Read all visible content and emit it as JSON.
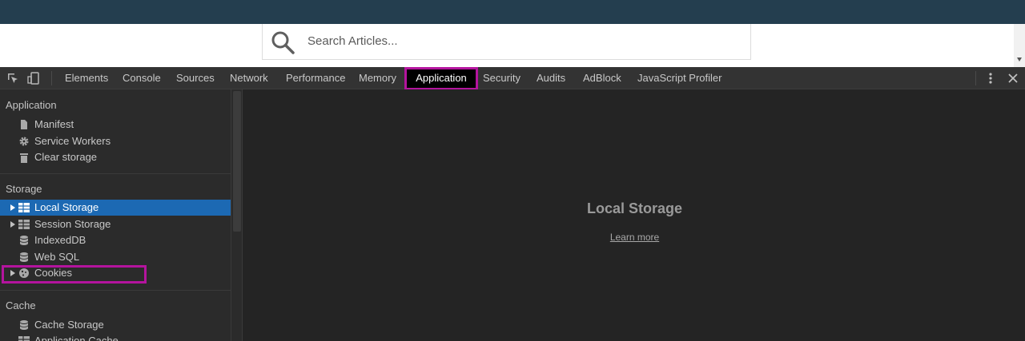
{
  "webpage": {
    "search": {
      "placeholder": "Search Articles..."
    }
  },
  "devtools": {
    "tabs": [
      {
        "label": "Elements"
      },
      {
        "label": "Console"
      },
      {
        "label": "Sources"
      },
      {
        "label": "Network"
      },
      {
        "label": "Performance"
      },
      {
        "label": "Memory"
      },
      {
        "label": "Application",
        "active": true
      },
      {
        "label": "Security"
      },
      {
        "label": "Audits"
      },
      {
        "label": "AdBlock"
      },
      {
        "label": "JavaScript Profiler"
      }
    ],
    "sidebar": {
      "sections": [
        {
          "title": "Application",
          "items": [
            {
              "label": "Manifest",
              "icon": "document-icon"
            },
            {
              "label": "Service Workers",
              "icon": "gear-icon"
            },
            {
              "label": "Clear storage",
              "icon": "trash-icon"
            }
          ]
        },
        {
          "title": "Storage",
          "items": [
            {
              "label": "Local Storage",
              "icon": "grid-icon",
              "expandable": true,
              "selected": true
            },
            {
              "label": "Session Storage",
              "icon": "grid-icon",
              "expandable": true
            },
            {
              "label": "IndexedDB",
              "icon": "database-icon"
            },
            {
              "label": "Web SQL",
              "icon": "database-icon"
            },
            {
              "label": "Cookies",
              "icon": "cookie-icon",
              "expandable": true
            }
          ]
        },
        {
          "title": "Cache",
          "items": [
            {
              "label": "Cache Storage",
              "icon": "database-icon"
            },
            {
              "label": "Application Cache",
              "icon": "grid-icon"
            }
          ]
        }
      ]
    },
    "main": {
      "title": "Local Storage",
      "link": "Learn more"
    },
    "colors": {
      "accent_highlight": "#b4149e",
      "selected_row": "#1c69b3",
      "page_header": "#243e4f"
    }
  }
}
